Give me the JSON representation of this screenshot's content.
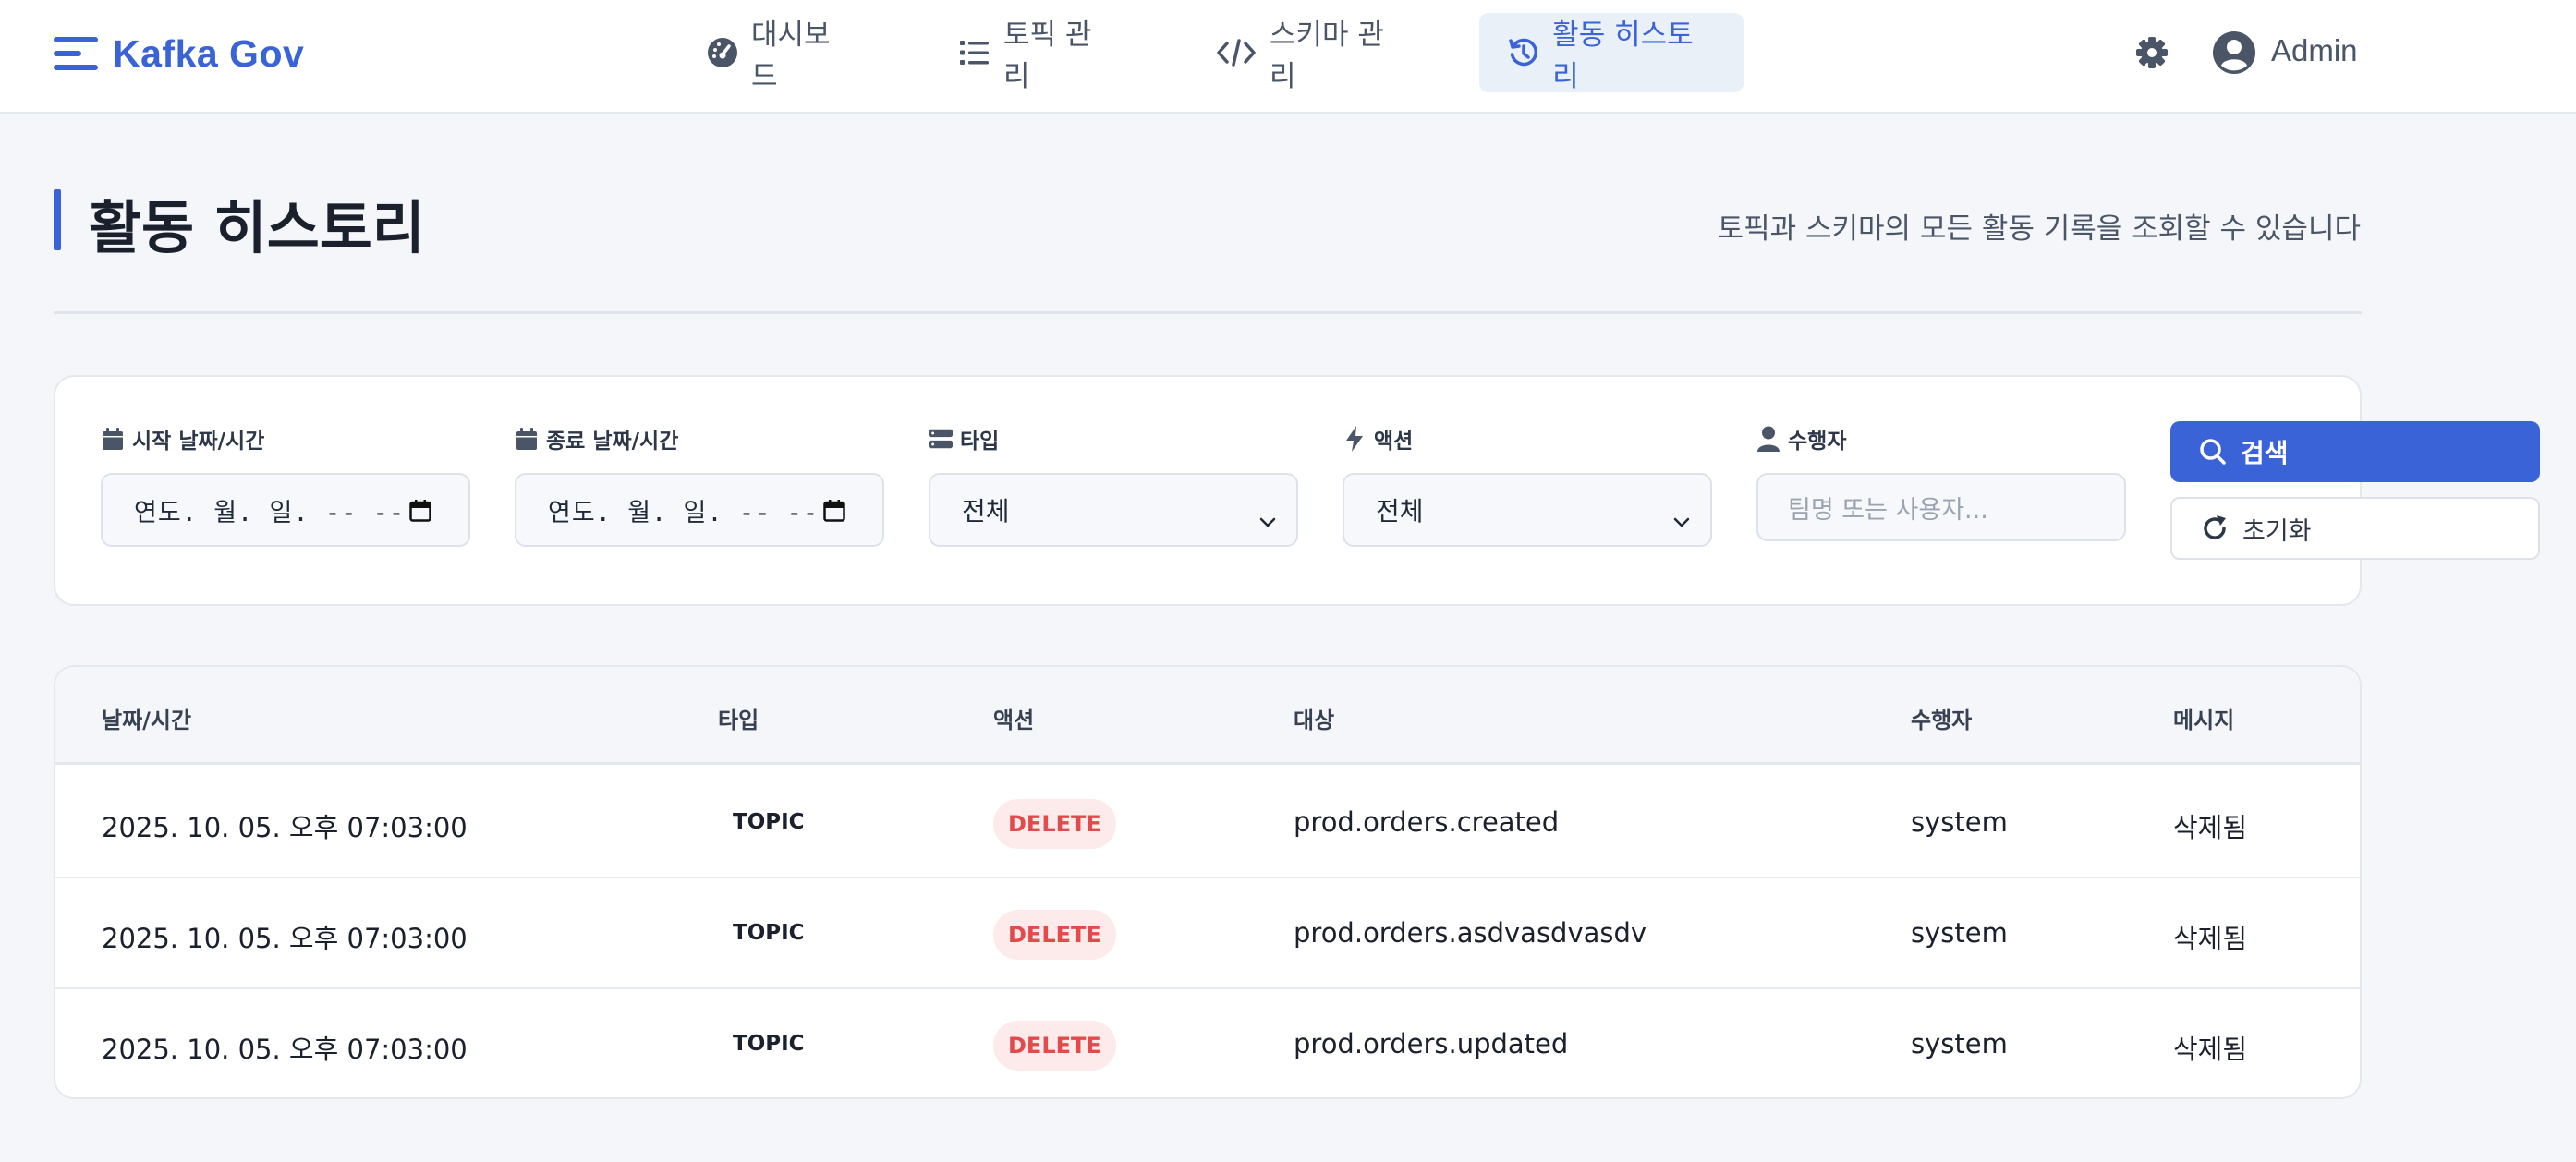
{
  "header": {
    "brand": "Kafka Gov",
    "nav": [
      {
        "label": "대시보드",
        "icon": "dashboard-gauge-icon",
        "active": false
      },
      {
        "label": "토픽 관리",
        "icon": "list-icon",
        "active": false
      },
      {
        "label": "스키마 관리",
        "icon": "code-icon",
        "active": false
      },
      {
        "label": "활동 히스토리",
        "icon": "history-icon",
        "active": true
      }
    ],
    "user": "Admin"
  },
  "page": {
    "title": "활동 히스토리",
    "description": "토픽과 스키마의 모든 활동 기록을 조회할 수 있습니다"
  },
  "filters": {
    "start": {
      "label": "시작 날짜/시간",
      "value": "연도. 월. 일. -- --"
    },
    "end": {
      "label": "종료 날짜/시간",
      "value": "연도. 월. 일. -- --"
    },
    "type": {
      "label": "타입",
      "value": "전체"
    },
    "action": {
      "label": "액션",
      "value": "전체"
    },
    "actor": {
      "label": "수행자",
      "placeholder": "팀명 또는 사용자..."
    },
    "search_label": "검색",
    "reset_label": "초기화"
  },
  "table": {
    "columns": [
      "날짜/시간",
      "타입",
      "액션",
      "대상",
      "수행자",
      "메시지"
    ],
    "rows": [
      {
        "datetime": "2025. 10. 05. 오후 07:03:00",
        "type": "TOPIC",
        "action": "DELETE",
        "target": "prod.orders.created",
        "actor": "system",
        "message": "삭제됨"
      },
      {
        "datetime": "2025. 10. 05. 오후 07:03:00",
        "type": "TOPIC",
        "action": "DELETE",
        "target": "prod.orders.asdvasdvasdv",
        "actor": "system",
        "message": "삭제됨"
      },
      {
        "datetime": "2025. 10. 05. 오후 07:03:00",
        "type": "TOPIC",
        "action": "DELETE",
        "target": "prod.orders.updated",
        "actor": "system",
        "message": "삭제됨"
      }
    ]
  },
  "colors": {
    "accent": "#3b63d8",
    "delete_badge_bg": "#fdeaea",
    "delete_badge_text": "#e24b4b"
  }
}
